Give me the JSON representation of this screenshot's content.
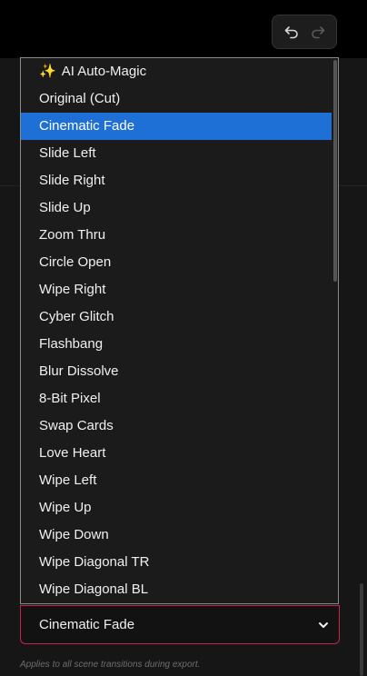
{
  "toolbar": {
    "undo_icon": "undo-icon",
    "redo_icon": "redo-icon"
  },
  "transition": {
    "selected": "Cinematic Fade",
    "options": [
      "AI Auto-Magic",
      "Original (Cut)",
      "Cinematic Fade",
      "Slide Left",
      "Slide Right",
      "Slide Up",
      "Zoom Thru",
      "Circle Open",
      "Wipe Right",
      "Cyber Glitch",
      "Flashbang",
      "Blur Dissolve",
      "8-Bit Pixel",
      "Swap Cards",
      "Love Heart",
      "Wipe Left",
      "Wipe Up",
      "Wipe Down",
      "Wipe Diagonal TR",
      "Wipe Diagonal BL"
    ],
    "caption": "Applies to all scene transitions during export."
  },
  "colors": {
    "accent_highlight": "#1e6fd6",
    "select_border": "#c4264a",
    "background": "#161616"
  }
}
